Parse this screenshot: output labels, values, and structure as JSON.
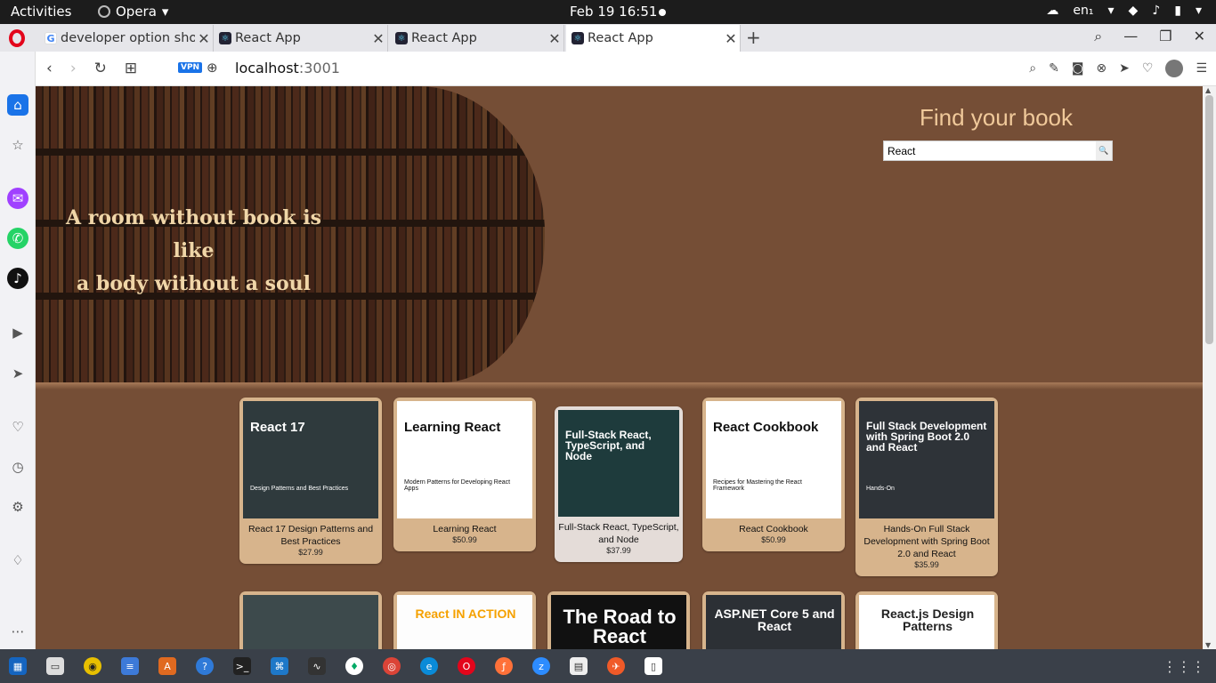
{
  "system": {
    "activities": "Activities",
    "app_name": "Opera",
    "clock": "Feb 19  16:51",
    "lang": "en₁"
  },
  "tabs": [
    {
      "title": "developer option sho",
      "icon": "google-icon"
    },
    {
      "title": "React App",
      "icon": "react-icon"
    },
    {
      "title": "React App",
      "icon": "react-icon"
    },
    {
      "title": "React App",
      "icon": "react-icon",
      "active": true
    }
  ],
  "address": {
    "vpn": "VPN",
    "host": "localhost",
    "port": ":3001"
  },
  "hero": {
    "quote_line1": "A room without book is like",
    "quote_line2": "a body without a soul"
  },
  "search": {
    "heading": "Find your book",
    "value": "React"
  },
  "books": [
    {
      "name": "React 17 Design Patterns and Best Practices",
      "price": "$27.99",
      "cover_title": "React 17",
      "cover_sub": "Design Patterns and Best Practices",
      "cover_bg": "#2f3a3d",
      "cover_fg": "#ffffff"
    },
    {
      "name": "Learning React",
      "price": "$50.99",
      "cover_title": "Learning React",
      "cover_sub": "Modern Patterns for Developing React Apps",
      "cover_bg": "#ffffff",
      "cover_fg": "#111111"
    },
    {
      "name": "Full-Stack React, TypeScript, and Node",
      "price": "$37.99",
      "cover_title": "Full-Stack React, TypeScript, and Node",
      "cover_sub": "",
      "cover_bg": "#1e3b3c",
      "cover_fg": "#ffffff"
    },
    {
      "name": "React Cookbook",
      "price": "$50.99",
      "cover_title": "React Cookbook",
      "cover_sub": "Recipes for Mastering the React Framework",
      "cover_bg": "#ffffff",
      "cover_fg": "#111111"
    },
    {
      "name": "Hands-On Full Stack Development with Spring Boot 2.0 and React",
      "price": "$35.99",
      "cover_title": "Full Stack Development with Spring Boot 2.0 and React",
      "cover_sub": "Hands-On",
      "cover_bg": "#2e3338",
      "cover_fg": "#ffffff"
    }
  ],
  "books_row2": [
    {
      "cover_title": "",
      "cover_bg": "#3d4a4c",
      "cover_fg": "#ffffff"
    },
    {
      "cover_title": "React IN ACTION",
      "cover_bg": "#fdfdfd",
      "cover_fg": "#f5a100"
    },
    {
      "cover_title": "The Road to React",
      "cover_bg": "#111111",
      "cover_fg": "#ffffff"
    },
    {
      "cover_title": "ASP.NET Core 5 and React",
      "cover_bg": "#2c3035",
      "cover_fg": "#ffffff"
    },
    {
      "cover_title": "React.js Design Patterns",
      "cover_bg": "#ffffff",
      "cover_fg": "#222222"
    }
  ],
  "colors": {
    "page_bg": "#754e36",
    "card_bg": "#d7b48c",
    "heading": "#f0c99a",
    "quote": "#f0d6a8",
    "opera_red": "#e3051b"
  }
}
